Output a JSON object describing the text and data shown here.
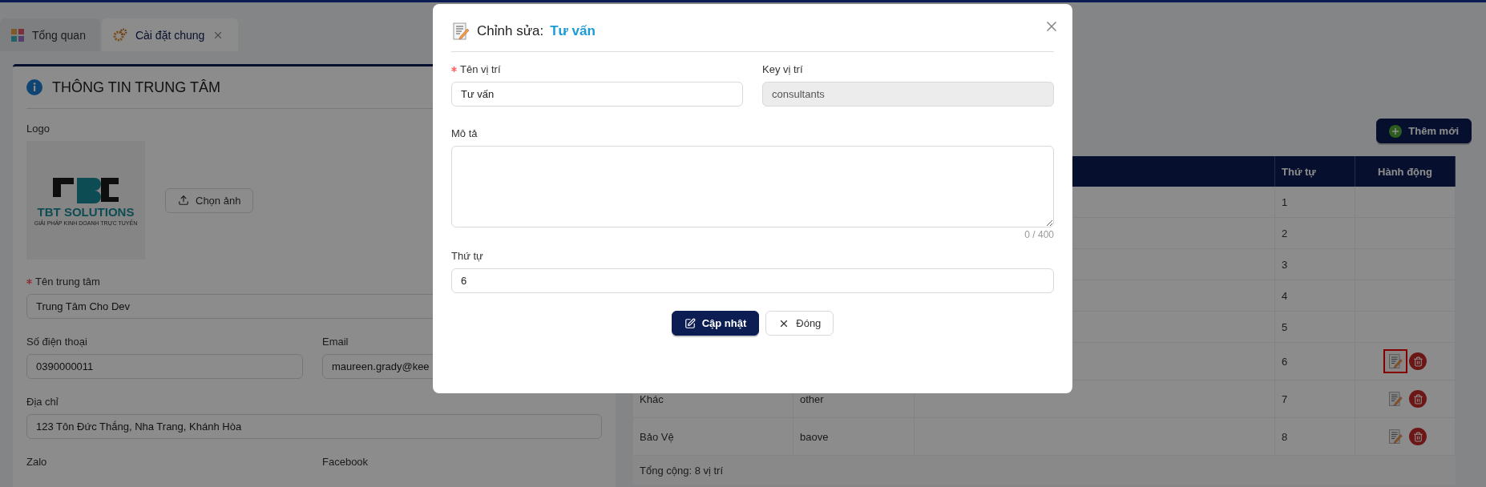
{
  "tabs": [
    {
      "label": "Tổng quan",
      "selected": false,
      "closable": false
    },
    {
      "label": "Cài đặt chung",
      "selected": true,
      "closable": true
    }
  ],
  "center_info": {
    "title": "THÔNG TIN TRUNG TÂM",
    "logo_label": "Logo",
    "logo": {
      "brand": "TBT SOLUTIONS",
      "tagline": "GIẢI PHÁP KINH DOANH TRỰC TUYẾN"
    },
    "upload_button": "Chọn ảnh",
    "field_rows": [
      [
        {
          "label": "Tên trung tâm",
          "required": true,
          "value": "Trung Tâm Cho Dev"
        }
      ],
      [
        {
          "label": "Số điện thoại",
          "required": false,
          "value": "0390000011"
        },
        {
          "label": "Email",
          "required": false,
          "value": "maureen.grady@kee"
        }
      ],
      [
        {
          "label": "Địa chỉ",
          "required": false,
          "value": "123 Tôn Đức Thắng, Nha Trang, Khánh Hòa"
        }
      ],
      [
        {
          "label": "Zalo",
          "required": false
        },
        {
          "label": "Facebook",
          "required": false
        }
      ]
    ]
  },
  "positions": {
    "add_button": "Thêm mới",
    "columns": [
      "Thứ tự",
      "Hành động"
    ],
    "rows": [
      {
        "order": "1",
        "actions": false
      },
      {
        "order": "2",
        "actions": false
      },
      {
        "order": "3",
        "actions": false
      },
      {
        "order": "4",
        "actions": false
      },
      {
        "order": "5",
        "actions": false
      },
      {
        "order": "6",
        "actions": true,
        "focused": true
      },
      {
        "name": "Khác",
        "key": "other",
        "order": "7",
        "actions": true,
        "focused": false
      },
      {
        "name": "Bảo Vệ",
        "key": "baove",
        "order": "8",
        "actions": true,
        "focused": false
      }
    ],
    "footer": "Tổng cộng: 8 vị trí"
  },
  "modal": {
    "title_prefix": "Chỉnh sửa:",
    "title_name": "Tư vấn",
    "name_field": {
      "label": "Tên vị trí",
      "required": true,
      "value": "Tư vấn"
    },
    "key_field": {
      "label": "Key vị trí",
      "required": false,
      "value": "consultants",
      "disabled": true
    },
    "description": {
      "label": "Mô tả",
      "counter": "0 / 400"
    },
    "order_field": {
      "label": "Thứ tự",
      "value": "6"
    },
    "buttons": [
      {
        "label": "Cập nhật",
        "kind": "primary"
      },
      {
        "label": "Đóng",
        "kind": "default"
      }
    ]
  }
}
